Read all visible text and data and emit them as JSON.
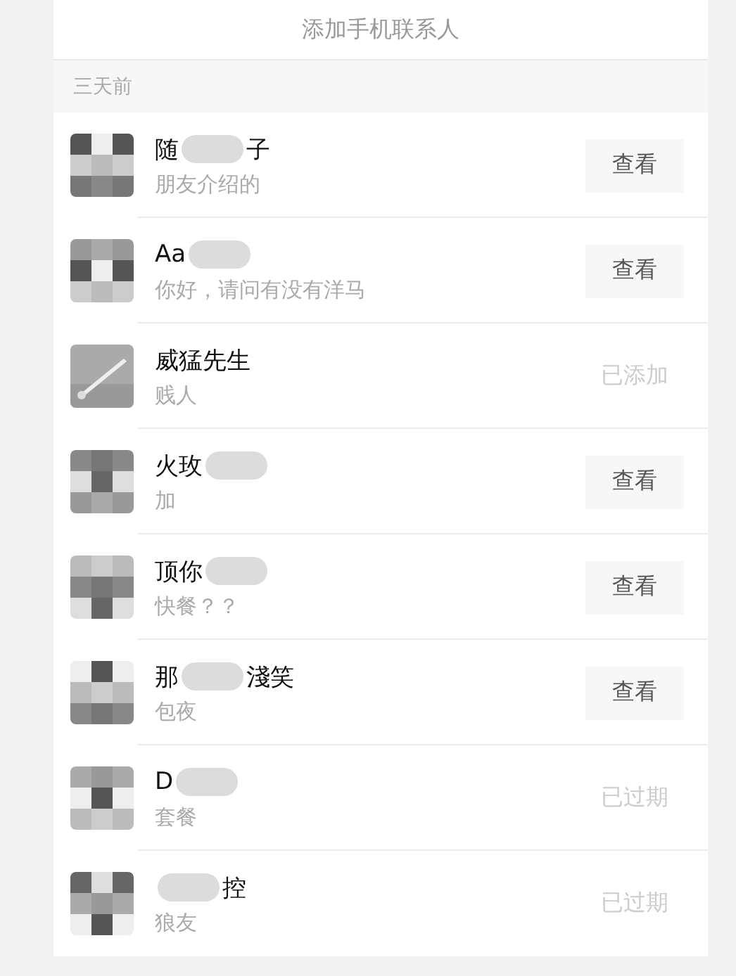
{
  "add_contacts": {
    "label": "添加手机联系人"
  },
  "section": {
    "title": "三天前"
  },
  "requests": [
    {
      "name": [
        {
          "kind": "text",
          "text": "随"
        },
        {
          "kind": "blur"
        },
        {
          "kind": "text",
          "text": "子"
        }
      ],
      "message": "朋友介绍的",
      "action": {
        "kind": "button",
        "label": "查看"
      }
    },
    {
      "name": [
        {
          "kind": "text",
          "text": "Aa"
        },
        {
          "kind": "blur"
        }
      ],
      "message": "你好，请问有没有洋马",
      "action": {
        "kind": "button",
        "label": "查看"
      }
    },
    {
      "name": [
        {
          "kind": "text",
          "text": "威猛先生"
        }
      ],
      "message": "贱人",
      "action": {
        "kind": "status",
        "label": "已添加"
      }
    },
    {
      "name": [
        {
          "kind": "text",
          "text": "火玫"
        },
        {
          "kind": "blur"
        }
      ],
      "message": "加",
      "action": {
        "kind": "button",
        "label": "查看"
      }
    },
    {
      "name": [
        {
          "kind": "text",
          "text": "顶你"
        },
        {
          "kind": "blur"
        }
      ],
      "message": "快餐？？",
      "action": {
        "kind": "button",
        "label": "查看"
      }
    },
    {
      "name": [
        {
          "kind": "text",
          "text": "那"
        },
        {
          "kind": "blur"
        },
        {
          "kind": "text",
          "text": "淺笑"
        }
      ],
      "message": "包夜",
      "action": {
        "kind": "button",
        "label": "查看"
      }
    },
    {
      "name": [
        {
          "kind": "text",
          "text": "D"
        },
        {
          "kind": "blur"
        }
      ],
      "message": "套餐",
      "action": {
        "kind": "status",
        "label": "已过期"
      }
    },
    {
      "name": [
        {
          "kind": "blur"
        },
        {
          "kind": "text",
          "text": "控"
        }
      ],
      "message": "狼友",
      "action": {
        "kind": "status",
        "label": "已过期"
      }
    }
  ]
}
